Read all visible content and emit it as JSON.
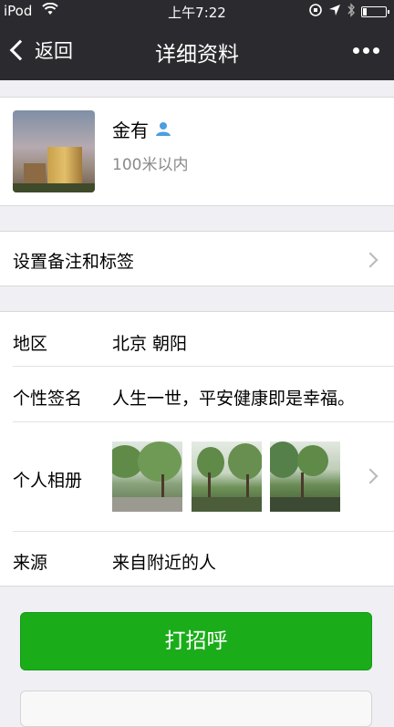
{
  "status_bar": {
    "carrier": "iPod",
    "time": "上午7:22",
    "battery_level": 0.2
  },
  "nav": {
    "back_label": "返回",
    "title": "详细资料"
  },
  "profile": {
    "name": "金有",
    "distance": "100米以内"
  },
  "remark": {
    "label": "设置备注和标签"
  },
  "details": {
    "region_label": "地区",
    "region_value": "北京  朝阳",
    "signature_label": "个性签名",
    "signature_value": "人生一世，平安健康即是幸福。",
    "album_label": "个人相册",
    "source_label": "来源",
    "source_value": "来自附近的人"
  },
  "actions": {
    "greet_label": "打招呼"
  },
  "colors": {
    "nav_bg": "#2b2b2f",
    "accent_green": "#1aad19",
    "page_bg": "#efeff4",
    "gender_icon": "#4a9fe0"
  },
  "icons": {
    "wifi": "wifi-icon",
    "location": "location-arrow-icon",
    "bluetooth": "bluetooth-icon",
    "orientation_lock": "orientation-lock-icon",
    "more": "more-dots-icon",
    "gender": "male-user-icon"
  }
}
